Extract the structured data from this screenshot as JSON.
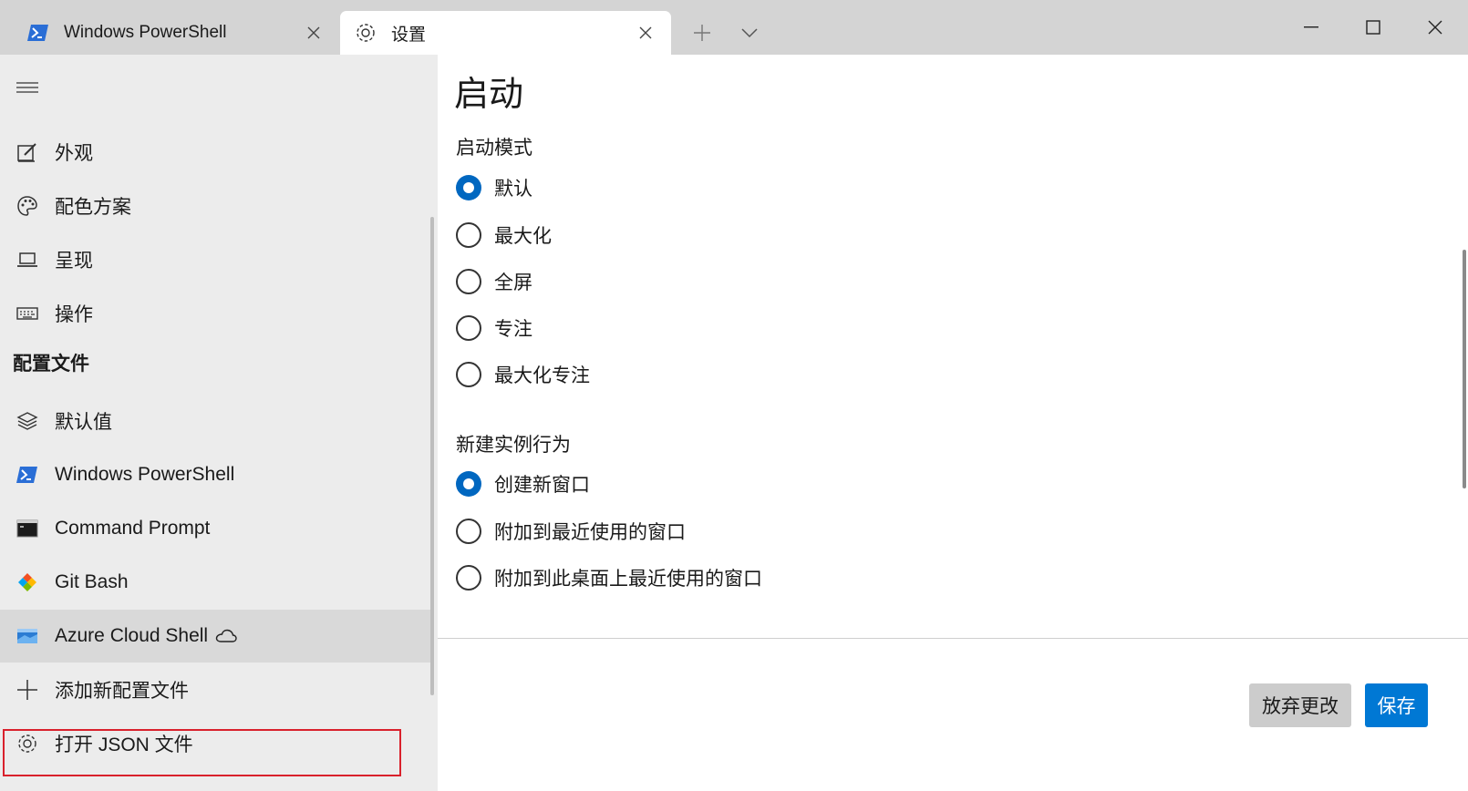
{
  "tabs": [
    {
      "title": "Windows PowerShell",
      "icon": "powershell-icon"
    },
    {
      "title": "设置",
      "icon": "gear-icon"
    }
  ],
  "colors": {
    "accent": "#0067c0",
    "save_button": "#0078d4",
    "highlight_box": "#d9212c",
    "sidebar_bg": "#ececec",
    "titlebar_bg": "#d4d4d4"
  },
  "sidebar": {
    "items": [
      {
        "label": "外观",
        "icon": "appearance-icon"
      },
      {
        "label": "配色方案",
        "icon": "palette-icon"
      },
      {
        "label": "呈现",
        "icon": "rendering-icon"
      },
      {
        "label": "操作",
        "icon": "keyboard-icon"
      }
    ],
    "profiles_header": "配置文件",
    "profiles": [
      {
        "label": "默认值",
        "icon": "layers-icon"
      },
      {
        "label": "Windows PowerShell",
        "icon": "powershell-icon"
      },
      {
        "label": "Command Prompt",
        "icon": "cmd-icon"
      },
      {
        "label": "Git Bash",
        "icon": "git-icon"
      },
      {
        "label": "Azure Cloud Shell",
        "icon": "azure-icon",
        "selected": true
      }
    ],
    "add_profile": "添加新配置文件",
    "open_json": "打开 JSON 文件"
  },
  "main": {
    "title": "启动",
    "launch_mode": {
      "label": "启动模式",
      "options": [
        "默认",
        "最大化",
        "全屏",
        "专注",
        "最大化专注"
      ],
      "selected": "默认"
    },
    "new_instance": {
      "label": "新建实例行为",
      "options": [
        "创建新窗口",
        "附加到最近使用的窗口",
        "附加到此桌面上最近使用的窗口"
      ],
      "selected": "创建新窗口"
    },
    "discard_button": "放弃更改",
    "save_button": "保存"
  }
}
